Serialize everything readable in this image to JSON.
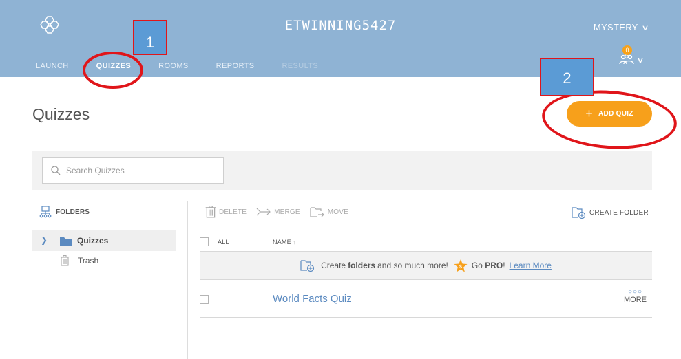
{
  "header": {
    "room_name": "ETWINNING5427",
    "user_menu": "MYSTERY",
    "notification_count": "0",
    "nav_tabs": [
      "LAUNCH",
      "QUIZZES",
      "ROOMS",
      "REPORTS",
      "RESULTS"
    ],
    "active_tab": "QUIZZES"
  },
  "annotations": {
    "callout_1": "1",
    "callout_2": "2",
    "marker_color": "#e0151a"
  },
  "page": {
    "title": "Quizzes",
    "add_quiz_label": "ADD QUIZ"
  },
  "search": {
    "placeholder": "Search Quizzes"
  },
  "sidebar": {
    "heading": "FOLDERS",
    "items": [
      {
        "label": "Quizzes",
        "selected": true
      },
      {
        "label": "Trash",
        "selected": false
      }
    ]
  },
  "toolbar": {
    "delete": "DELETE",
    "merge": "MERGE",
    "move": "MOVE",
    "create_folder": "CREATE FOLDER"
  },
  "table": {
    "col_all": "ALL",
    "col_name": "NAME",
    "promo": {
      "pre": "Create",
      "bold1": "folders",
      "mid": "and so much more!",
      "go": "Go",
      "bold2": "PRO",
      "bang": "!",
      "link": "Learn More"
    },
    "rows": [
      {
        "name": "World Facts Quiz",
        "more": "MORE"
      }
    ]
  },
  "colors": {
    "header_bg": "#8fb3d4",
    "accent_orange": "#f7a01b",
    "link_blue": "#5b8ac0"
  }
}
